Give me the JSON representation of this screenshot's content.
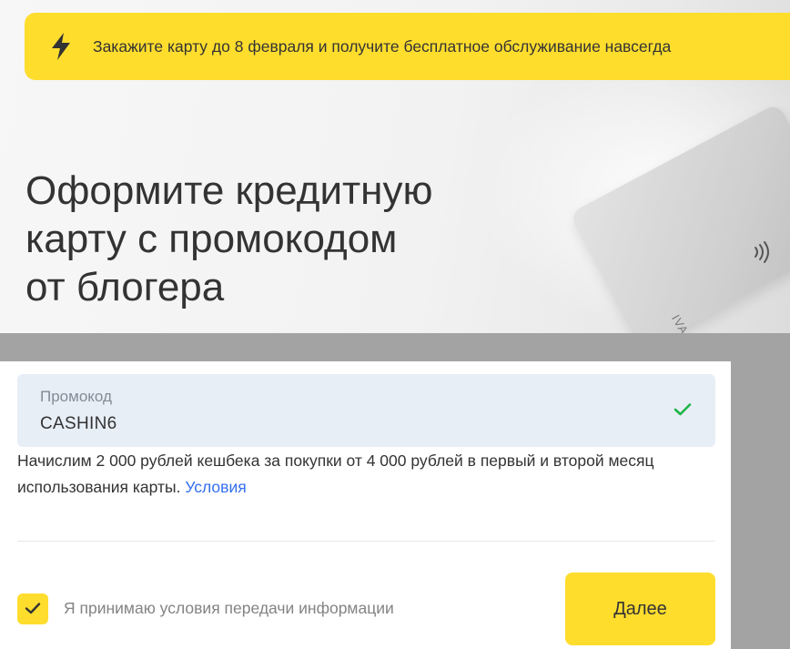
{
  "banner": {
    "text": "Закажите карту до 8 февраля и получите бесплатное обслуживание навсегда",
    "icon": "lightning-icon"
  },
  "hero": {
    "title_line1": "Оформите кредитную",
    "title_line2": "карту с промокодом",
    "title_line3": "от блогера",
    "card_name_partial": "IVA"
  },
  "form": {
    "promo_label": "Промокод",
    "promo_value": "CASHIN6",
    "promo_status_icon": "check-icon",
    "cashback_text": "Начислим 2 000 рублей кешбека за покупки от 4 000 рублей в первый и второй месяц использования карты.",
    "conditions_link": "Условия",
    "accept_checked": true,
    "accept_label": "Я принимаю условия передачи информации",
    "next_button": "Далее"
  },
  "colors": {
    "accent": "#ffdd2d",
    "link": "#336fee",
    "success": "#1db448",
    "input_bg": "#e8eef6"
  }
}
